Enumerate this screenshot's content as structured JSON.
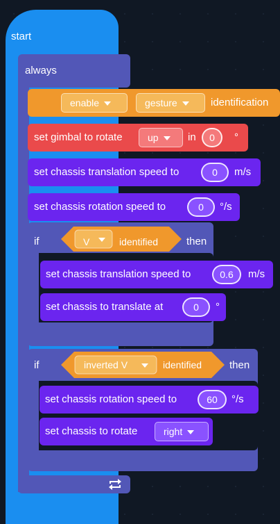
{
  "start": {
    "label": "start"
  },
  "always": {
    "label": "always",
    "repeat_icon": "repeat-icon"
  },
  "gesture_block": {
    "toggle_value": "enable",
    "target_value": "gesture",
    "suffix": "identification"
  },
  "gimbal_block": {
    "prefix": "set gimbal to rotate",
    "direction_value": "up",
    "in_label": "in",
    "angle_value": "0",
    "unit": "°"
  },
  "translation_speed_block": {
    "label": "set chassis translation speed to",
    "value": "0",
    "unit": "m/s"
  },
  "rotation_speed_block": {
    "label": "set chassis rotation speed to",
    "value": "0",
    "unit": "°/s"
  },
  "if_v": {
    "if_label": "if",
    "condition_value": "V",
    "condition_suffix": "identified",
    "then_label": "then",
    "translation_speed": {
      "label": "set chassis translation speed to",
      "value": "0.6",
      "unit": "m/s"
    },
    "translate_angle": {
      "label": "set chassis to translate at",
      "value": "0",
      "unit": "°"
    }
  },
  "if_inverted_v": {
    "if_label": "if",
    "condition_value": "inverted V",
    "condition_suffix": "identified",
    "then_label": "then",
    "rotation_speed": {
      "label": "set chassis rotation speed to",
      "value": "60",
      "unit": "°/s"
    },
    "rotate_direction": {
      "label": "set chassis to rotate",
      "value": "right"
    }
  },
  "colors": {
    "event": "#1a8ef0",
    "control": "#5257b7",
    "vision": "#f0982c",
    "gimbal": "#ea4a4b",
    "chassis": "#6b25ef",
    "canvas": "#101824"
  }
}
